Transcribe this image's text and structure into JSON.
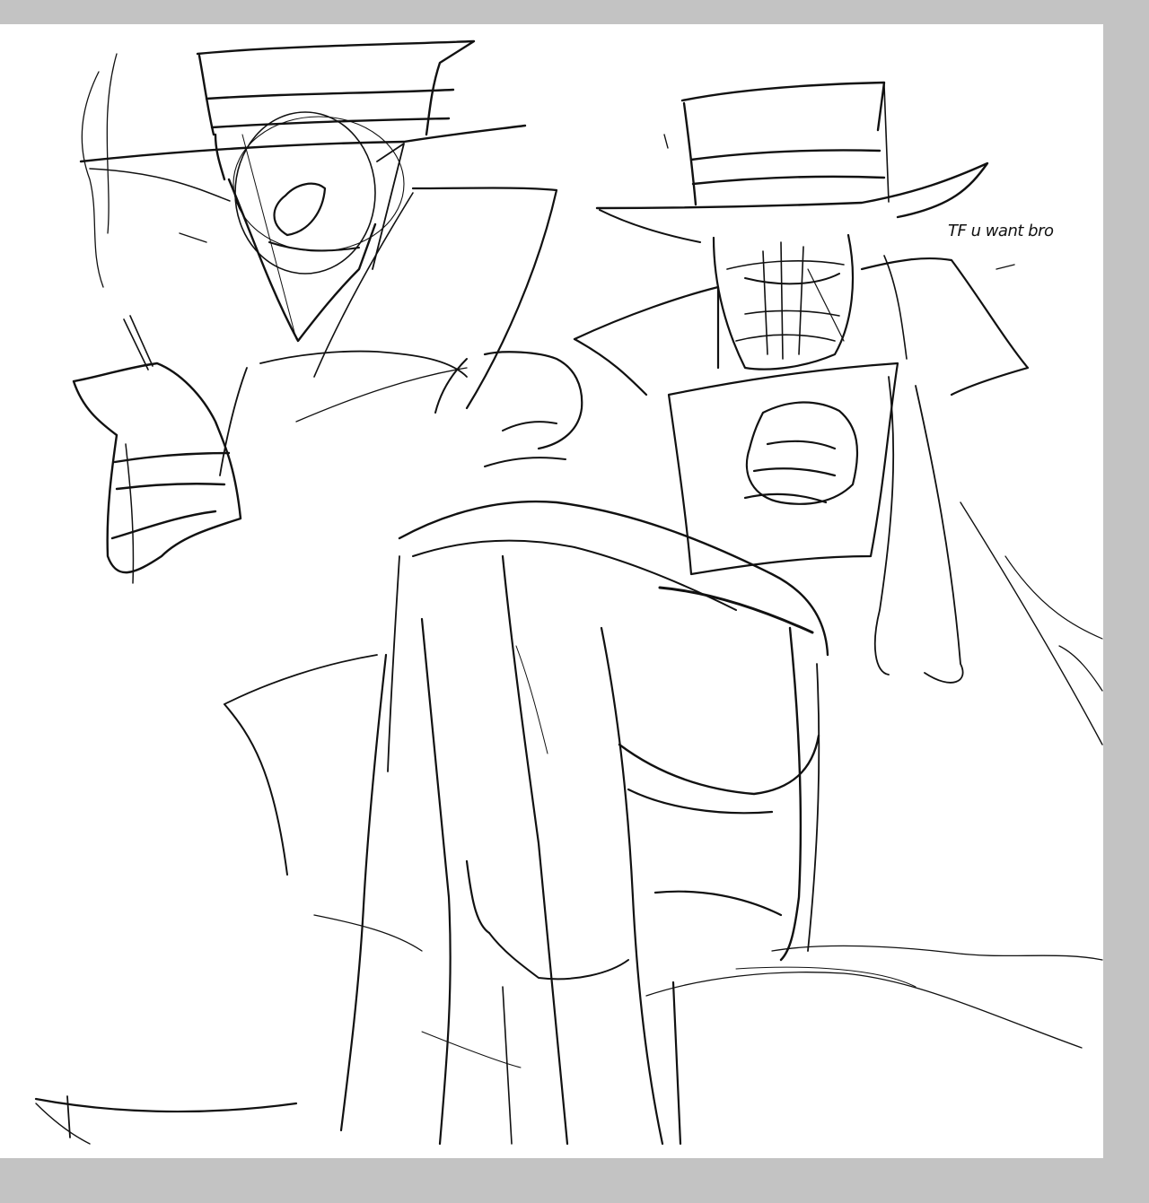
{
  "canvas": {
    "background": "#ffffff",
    "frame": "#c3c3c3",
    "ink": "#111111"
  },
  "sketch": {
    "caption": "TF u want bro"
  }
}
